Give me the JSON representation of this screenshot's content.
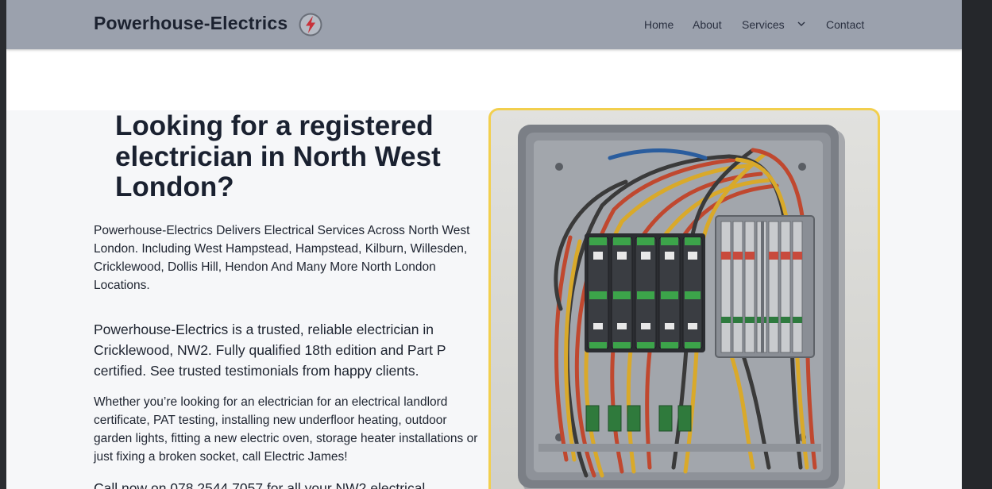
{
  "brand": {
    "name": "Powerhouse-Electrics",
    "accent": "#c8323a"
  },
  "nav": {
    "items": [
      {
        "label": "Home"
      },
      {
        "label": "About"
      },
      {
        "label": "Services"
      },
      {
        "label": "Contact"
      }
    ]
  },
  "hero": {
    "title": "Looking for a registered electrician in North West London?",
    "p1": "Powerhouse-Electrics Delivers Electrical Services Across North West London. Including West Hampstead, Hampstead, Kilburn, Willesden, Cricklewood, Dollis Hill, Hendon And Many More North London Locations.",
    "p2": "Powerhouse-Electrics is a trusted, reliable electrician in Cricklewood, NW2. Fully qualified 18th edition and Part P certified. See trusted testimonials from happy clients.",
    "p3": "Whether you’re looking for an electrician for an electrical landlord certificate, PAT testing, installing new underfloor heating, outdoor garden lights, fitting a new electric oven, storage heater installations or just fixing a broken socket, call Electric James!",
    "p4": "Call now on 078 2544 7057 for all your NW2 electrical",
    "image_frame_color": "#f2cf4e"
  }
}
